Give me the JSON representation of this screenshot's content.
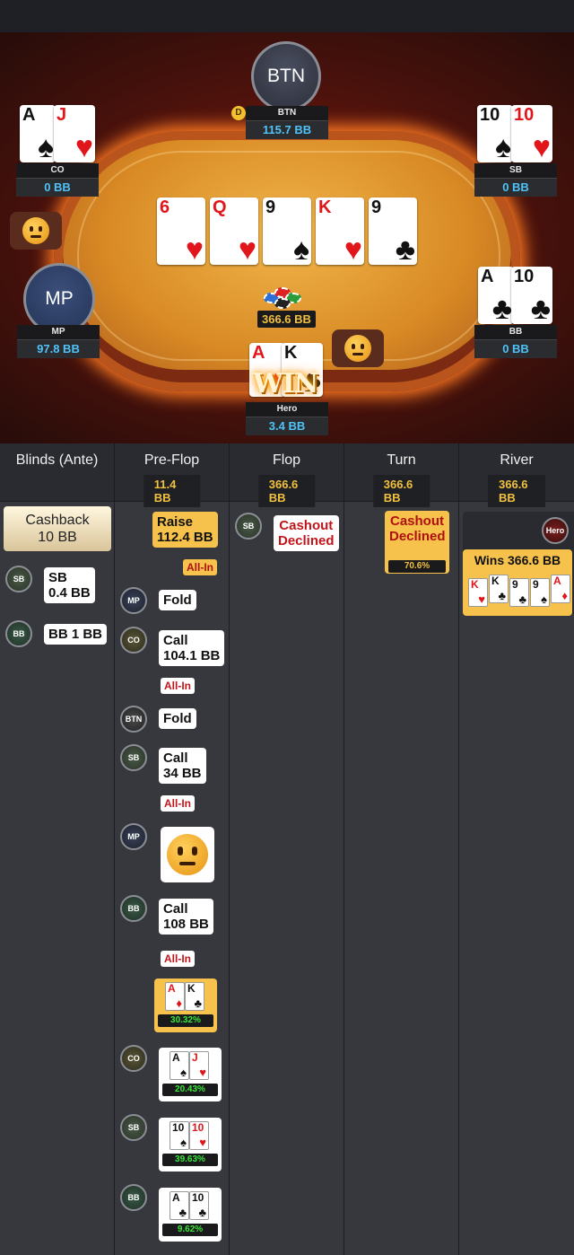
{
  "table": {
    "pot": "366.6 BB",
    "dealer_label": "D",
    "win_label": "WIN",
    "seats": {
      "btn": {
        "avatar": "BTN",
        "name": "BTN",
        "stack": "115.7 BB"
      },
      "co": {
        "name": "CO",
        "stack": "0 BB",
        "cards": [
          {
            "rank": "A",
            "suit": "♠",
            "color": "blk"
          },
          {
            "rank": "J",
            "suit": "♥",
            "color": "red"
          }
        ]
      },
      "sb": {
        "name": "SB",
        "stack": "0 BB",
        "cards": [
          {
            "rank": "10",
            "suit": "♠",
            "color": "blk"
          },
          {
            "rank": "10",
            "suit": "♥",
            "color": "red"
          }
        ]
      },
      "mp": {
        "avatar": "MP",
        "name": "MP",
        "stack": "97.8 BB"
      },
      "bb": {
        "name": "BB",
        "stack": "0 BB",
        "cards": [
          {
            "rank": "A",
            "suit": "♣",
            "color": "blk"
          },
          {
            "rank": "10",
            "suit": "♣",
            "color": "blk"
          }
        ]
      },
      "hero": {
        "name": "Hero",
        "stack": "3.4 BB",
        "cards": [
          {
            "rank": "A",
            "suit": "♦",
            "color": "red"
          },
          {
            "rank": "K",
            "suit": "♣",
            "color": "blk"
          }
        ]
      }
    },
    "board": [
      {
        "rank": "6",
        "suit": "♥",
        "color": "red"
      },
      {
        "rank": "Q",
        "suit": "♥",
        "color": "red"
      },
      {
        "rank": "9",
        "suit": "♠",
        "color": "blk"
      },
      {
        "rank": "K",
        "suit": "♥",
        "color": "red"
      },
      {
        "rank": "9",
        "suit": "♣",
        "color": "blk"
      }
    ]
  },
  "history": {
    "columns": [
      {
        "title": "Blinds (Ante)",
        "pot": ""
      },
      {
        "title": "Pre-Flop",
        "pot": "11.4 BB"
      },
      {
        "title": "Flop",
        "pot": "366.6 BB"
      },
      {
        "title": "Turn",
        "pot": "366.6 BB"
      },
      {
        "title": "River",
        "pot": "366.6 BB"
      }
    ],
    "blinds": {
      "cashback": "Cashback\n10 BB",
      "cashback_l1": "Cashback",
      "cashback_l2": "10 BB",
      "sb_pos": "SB",
      "sb_l1": "SB",
      "sb_l2": "0.4 BB",
      "bb_pos": "BB",
      "bb_text": "BB 1 BB"
    },
    "preflop": {
      "raise_l1": "Raise",
      "raise_l2": "112.4 BB",
      "allin": "All-In",
      "mp_pos": "MP",
      "mp_fold": "Fold",
      "co_pos": "CO",
      "co_l1": "Call",
      "co_l2": "104.1 BB",
      "btn_pos": "BTN",
      "btn_fold": "Fold",
      "sb_pos": "SB",
      "sb_l1": "Call",
      "sb_l2": "34 BB",
      "mp2_pos": "MP",
      "bb_pos": "BB",
      "bb_l1": "Call",
      "bb_l2": "108 BB",
      "hero_equity": "30.32%",
      "co_equity": "20.43%",
      "sb_equity": "39.63%",
      "bb_equity": "9.62%"
    },
    "flop": {
      "sb_pos": "SB",
      "l1": "Cashout",
      "l2": "Declined"
    },
    "turn": {
      "l1": "Cashout",
      "l2": "Declined",
      "pct": "70.6%"
    },
    "river": {
      "hero_pos": "Hero",
      "wins": "Wins 366.6 BB",
      "cards": [
        {
          "rank": "K",
          "suit": "♥",
          "color": "red"
        },
        {
          "rank": "K",
          "suit": "♣",
          "color": "blk"
        },
        {
          "rank": "9",
          "suit": "♣",
          "color": "blk"
        },
        {
          "rank": "9",
          "suit": "♠",
          "color": "blk"
        },
        {
          "rank": "A",
          "suit": "♦",
          "color": "red"
        }
      ]
    }
  },
  "colors": {
    "accent_gold": "#f6c24c",
    "stack_blue": "#4fc3f7",
    "equity_green": "#39e639",
    "allin_red": "#c0161b"
  }
}
